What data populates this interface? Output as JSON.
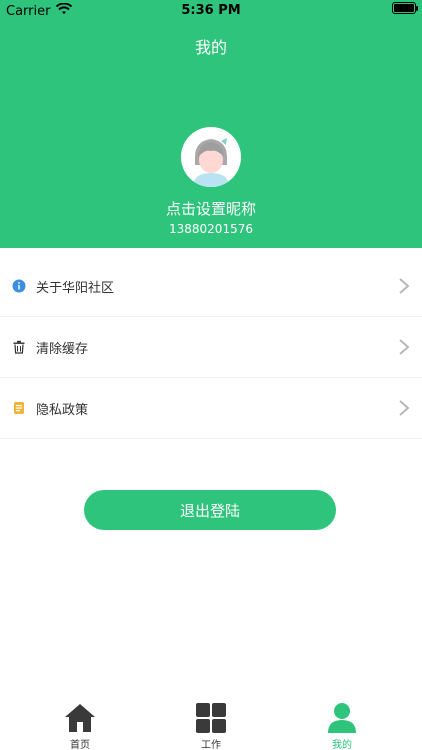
{
  "status_bar": {
    "carrier": "Carrier",
    "time": "5:36 PM"
  },
  "header": {
    "title": "我的"
  },
  "profile": {
    "nickname": "点击设置昵称",
    "phone": "13880201576"
  },
  "menu": {
    "items": [
      {
        "label": "关于华阳社区",
        "icon": "info-icon"
      },
      {
        "label": "清除缓存",
        "icon": "trash-icon"
      },
      {
        "label": "隐私政策",
        "icon": "document-icon"
      }
    ]
  },
  "logout": {
    "label": "退出登陆"
  },
  "tabs": [
    {
      "label": "首页",
      "icon": "home-icon",
      "active": false
    },
    {
      "label": "工作",
      "icon": "grid-icon",
      "active": false
    },
    {
      "label": "我的",
      "icon": "user-icon",
      "active": true
    }
  ],
  "colors": {
    "primary": "#2ec47c"
  }
}
